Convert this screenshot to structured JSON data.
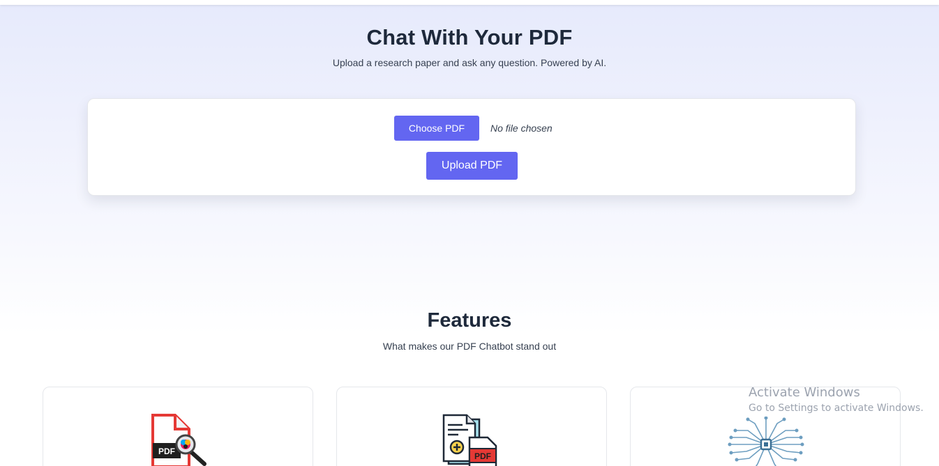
{
  "hero": {
    "title": "Chat With Your PDF",
    "subtitle": "Upload a research paper and ask any question. Powered by AI."
  },
  "upload": {
    "choose_label": "Choose PDF",
    "file_status": "No file chosen",
    "upload_label": "Upload PDF"
  },
  "features": {
    "title": "Features",
    "subtitle": "What makes our PDF Chatbot stand out",
    "cards": [
      {
        "icon": "pdf-search-icon"
      },
      {
        "icon": "add-pdf-document-icon"
      },
      {
        "icon": "ai-brain-circuit-icon"
      }
    ]
  },
  "watermark": {
    "line1": "Activate Windows",
    "line2": "Go to Settings to activate Windows."
  },
  "colors": {
    "accent": "#6366f1",
    "heading": "#1e293b",
    "pdf_red": "#e53935",
    "circuit_blue": "#5b8fb0"
  }
}
